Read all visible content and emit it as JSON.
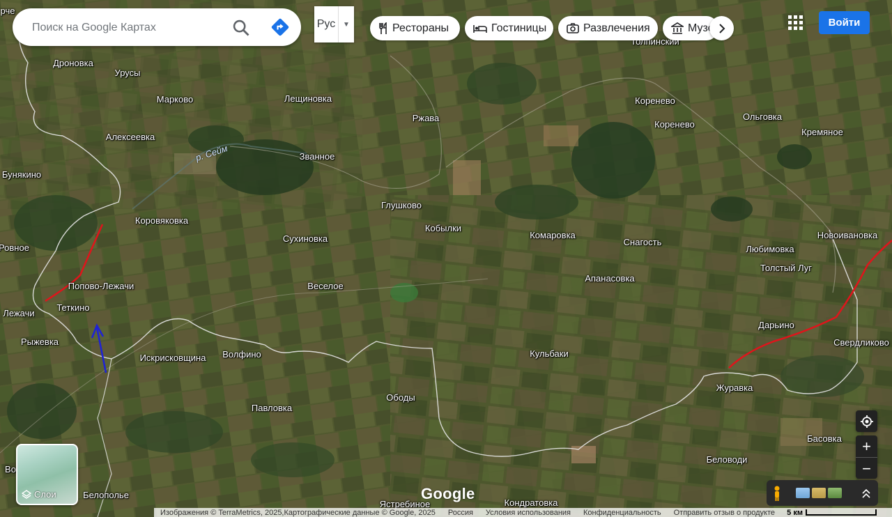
{
  "search": {
    "placeholder": "Поиск на Google Картах"
  },
  "language": {
    "value": "Рус"
  },
  "chips": [
    {
      "label": "Рестораны",
      "icon": "restaurant-icon"
    },
    {
      "label": "Гостиницы",
      "icon": "hotel-icon"
    },
    {
      "label": "Развлечения",
      "icon": "camera-icon"
    },
    {
      "label": "Музеи",
      "icon": "museum-icon"
    }
  ],
  "header": {
    "login_label": "Войти"
  },
  "layers": {
    "label": "Слои"
  },
  "brand": {
    "logo": "Google"
  },
  "places": [
    {
      "name": "Дроновка"
    },
    {
      "name": "Урусы"
    },
    {
      "name": "Марково"
    },
    {
      "name": "Лещиновка"
    },
    {
      "name": "Ржава"
    },
    {
      "name": "Толпинский"
    },
    {
      "name": "Коренево"
    },
    {
      "name": "Коренево"
    },
    {
      "name": "Ольговка"
    },
    {
      "name": "Кремяное"
    },
    {
      "name": "Алексеевка"
    },
    {
      "name": "Бунякино"
    },
    {
      "name": "Званное"
    },
    {
      "name": "Глушково"
    },
    {
      "name": "Кобылки"
    },
    {
      "name": "Коровяковка"
    },
    {
      "name": "Комаровка"
    },
    {
      "name": "Снагость"
    },
    {
      "name": "Любимовка"
    },
    {
      "name": "Новоивановка"
    },
    {
      "name": "Ровное"
    },
    {
      "name": "Сухиновка"
    },
    {
      "name": "Толстый Луг"
    },
    {
      "name": "Апанасовка"
    },
    {
      "name": "Попово-Лежачи"
    },
    {
      "name": "Веселое"
    },
    {
      "name": "Теткино"
    },
    {
      "name": "Лежачи"
    },
    {
      "name": "Дарьино"
    },
    {
      "name": "Рыжевка"
    },
    {
      "name": "Свердликово"
    },
    {
      "name": "Кульбаки"
    },
    {
      "name": "Искрисковщина"
    },
    {
      "name": "Волфино"
    },
    {
      "name": "Журавка"
    },
    {
      "name": "Ободы"
    },
    {
      "name": "Павловка"
    },
    {
      "name": "Басовка"
    },
    {
      "name": "Беловоди"
    },
    {
      "name": "Белополье"
    },
    {
      "name": "Ястребиное"
    },
    {
      "name": "Кондратовка"
    },
    {
      "name": "Во"
    },
    {
      "name": "рче"
    }
  ],
  "river": {
    "name": "р. Сейм"
  },
  "footer": {
    "attribution": "Изображения © TerraMetrics, 2025,Картографические данные © Google, 2025",
    "country": "Россия",
    "terms": "Условия использования",
    "privacy": "Конфиденциальность",
    "feedback": "Отправить отзыв о продукте",
    "scale": "5 км"
  },
  "colors": {
    "route": "#e0141b",
    "arrow": "#1e22d6",
    "border": "#e6e6e6",
    "accent": "#1a73e8"
  }
}
